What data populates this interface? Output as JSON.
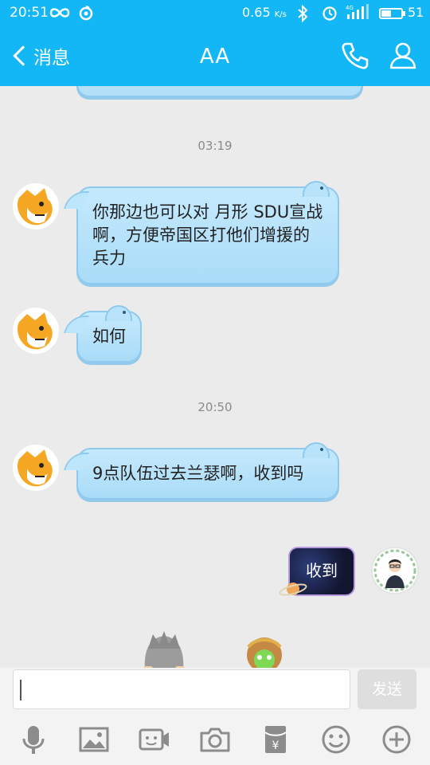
{
  "status_bar": {
    "time": "20:51",
    "speed_value": "0.65",
    "speed_unit": "K/s",
    "network": "4G",
    "battery_percent": 51
  },
  "header": {
    "back_label": "消息",
    "title": "AA"
  },
  "messages": [
    {
      "kind": "timestamp",
      "text": "03:19"
    },
    {
      "kind": "received",
      "text": "你那边也可以对 月形 SDU宣战啊，方便帝国区打他们增援的兵力"
    },
    {
      "kind": "received",
      "text": "如何"
    },
    {
      "kind": "timestamp",
      "text": "20:50"
    },
    {
      "kind": "received",
      "text": "9点队伍过去兰瑟啊，收到吗"
    },
    {
      "kind": "sent",
      "text": "收到"
    }
  ],
  "input": {
    "value": "",
    "send_label": "发送"
  },
  "toolbar": {
    "icons": [
      "microphone-icon",
      "image-icon",
      "video-icon",
      "camera-icon",
      "red-packet-icon",
      "emoji-icon",
      "plus-icon"
    ]
  },
  "colors": {
    "header_bg": "#13b7f5",
    "bubble_fill": "#b9e3fb",
    "bubble_border": "#8ec9ef"
  }
}
